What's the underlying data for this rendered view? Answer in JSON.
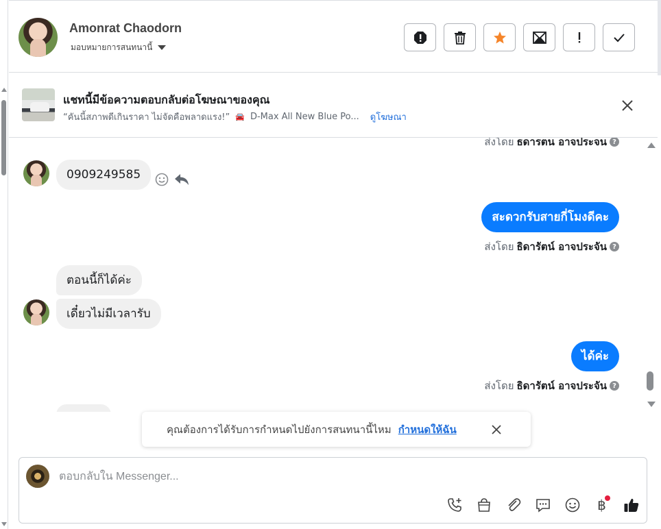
{
  "header": {
    "contact_name": "Amonrat Chaodorn",
    "assign_label": "มอบหมายการสนทนานี้",
    "actions": [
      {
        "name": "spam-button",
        "icon": "exclamation-octagon-icon"
      },
      {
        "name": "delete-button",
        "icon": "trash-icon"
      },
      {
        "name": "star-button",
        "icon": "star-icon"
      },
      {
        "name": "mark-unread-button",
        "icon": "envelope-icon"
      },
      {
        "name": "follow-up-button",
        "icon": "exclamation-icon"
      },
      {
        "name": "done-button",
        "icon": "checkmark-icon"
      }
    ],
    "star_color": "#f5852a"
  },
  "ad_banner": {
    "title": "แชทนี้มีข้อความตอบกลับต่อโฆษณาของคุณ",
    "quote": "“คันนี้สภาพดีเกินราคา ไม่จัดคือพลาดแรง!”",
    "car_emoji": "🚘",
    "ad_name": "D-Max All New Blue Po...",
    "view_ad_link": "ดูโฆษณา"
  },
  "messages": {
    "sent_by_prefix": "ส่งโดย",
    "agent_name": "ธิดารัตน์ อาจประจัน",
    "agent_name_cut": "ธดารตน อาจประจน",
    "items": [
      {
        "from": "customer",
        "text": "0909249585"
      },
      {
        "from": "page",
        "text": "สะดวกรับสายกี่โมงดีคะ"
      },
      {
        "from": "customer",
        "text": "ตอนนี้ก็ได้ค่ะ"
      },
      {
        "from": "customer",
        "text": "เดี๋ยวไม่มีเวลารับ"
      },
      {
        "from": "page",
        "text": "ได้ค่ะ"
      }
    ],
    "help_mark": "?",
    "outgoing_color": "#0a7cff"
  },
  "toast": {
    "text": "คุณต้องการได้รับการกำหนดไปยังการสนทนานี้ไหม",
    "link": "กำหนดให้ฉัน"
  },
  "composer": {
    "placeholder": "ตอบกลับใน Messenger...",
    "tools": [
      "phone-add-icon",
      "shopping-bag-icon",
      "paperclip-icon",
      "chat-bubble-icon",
      "emoji-icon",
      "baht-icon",
      "thumbs-up-icon"
    ],
    "baht_symbol": "฿"
  }
}
